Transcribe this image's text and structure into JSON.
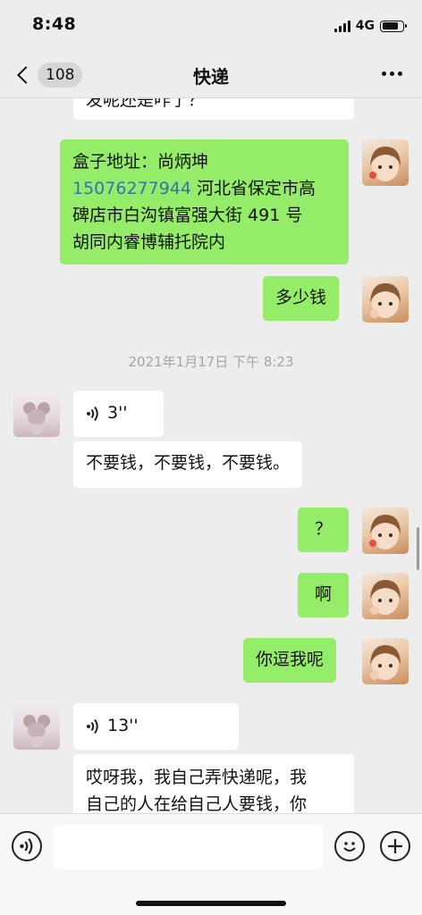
{
  "status_bar": {
    "time": "8:48",
    "network": "4G",
    "battery_level": 0.8
  },
  "nav": {
    "unread_count": "108",
    "title": "快递"
  },
  "messages": [
    {
      "side": "left",
      "text": "发呢还是咋了？",
      "note": "partially scrolled out of view"
    },
    {
      "side": "right",
      "text_before": "盒子地址：尚炳坤",
      "phone": "15076277944",
      "text_after": "河北省保定市高碑店市白沟镇富强大街 491 号胡同内睿博辅托院内"
    },
    {
      "side": "right",
      "text": "多少钱"
    },
    {
      "side": "right",
      "text": "？"
    },
    {
      "side": "right",
      "text": "啊"
    },
    {
      "side": "right",
      "text": "你逗我呢"
    }
  ],
  "address_lines": [
    "盒子地址：尚炳坤",
    "15076277944",
    "河北省保定市高",
    "碑店市白沟镇富强大街 491 号",
    "胡同内睿博辅托院内"
  ],
  "timestamp": "2021年1月17日 下午 8:23",
  "voice_messages": [
    {
      "duration": "3''"
    },
    {
      "duration": "13''"
    }
  ],
  "texts": {
    "partial_top": "发呢还是咋了？",
    "how_much": "多少钱",
    "no_money": "不要钱，不要钱，不要钱。",
    "question": "？",
    "ah": "啊",
    "kidding": "你逗我呢",
    "long_line1": "哎呀我，我自己弄快递呢，我",
    "long_line2": "自己的人在给自己人要钱，你"
  },
  "input": {
    "placeholder": ""
  },
  "icons": {
    "voice_toggle": "voice-icon",
    "emoji": "emoji-icon",
    "add": "plus-icon",
    "back": "chevron-left-icon",
    "more": "more-icon"
  },
  "colors": {
    "background": "#ededed",
    "green_bubble": "#95ec69",
    "white_bubble": "#ffffff",
    "phone_link": "#3a6fb0"
  }
}
